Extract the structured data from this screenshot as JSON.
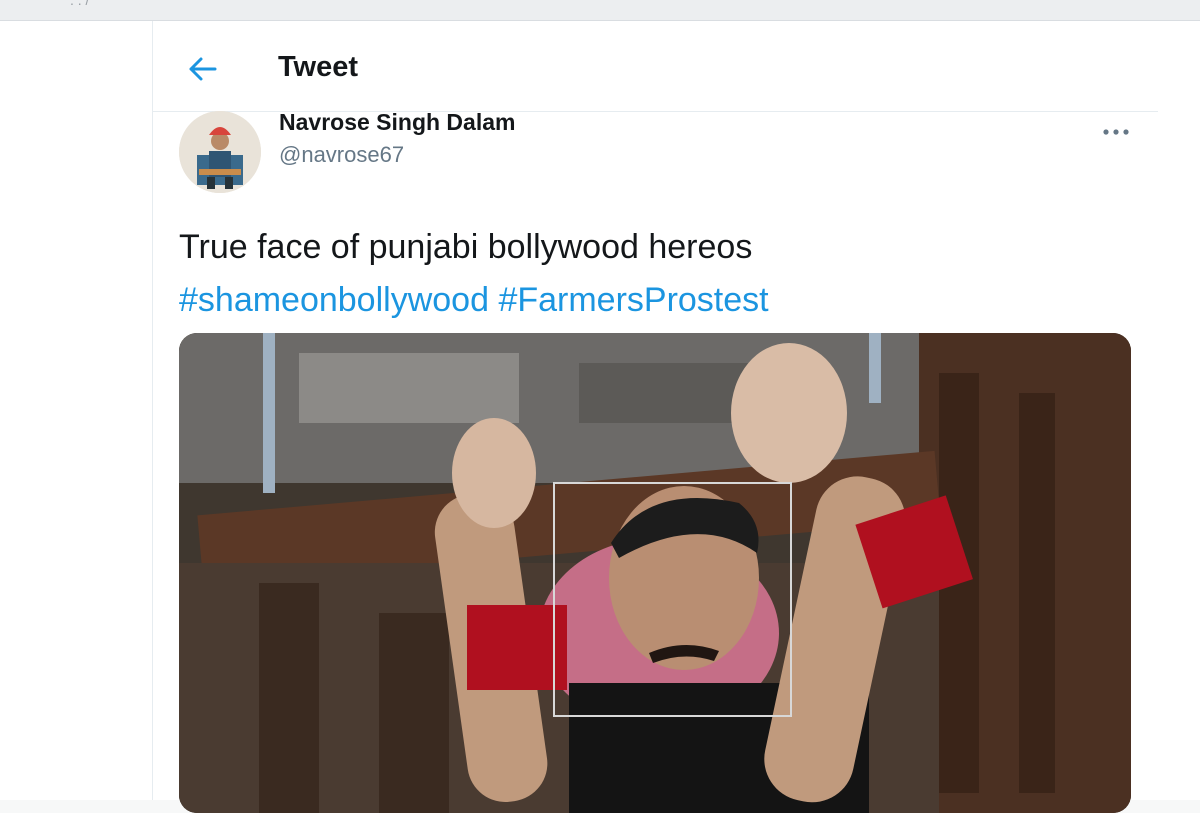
{
  "header": {
    "title": "Tweet"
  },
  "tweet": {
    "author": {
      "display_name": "Navrose Singh Dalam",
      "handle": "@navrose67"
    },
    "text": "True face of punjabi bollywood hereos",
    "hashtags": [
      "#shameonbollywood",
      "#FarmersProstest"
    ]
  },
  "colors": {
    "accent": "#1b95e0",
    "text": "#14171a",
    "secondary": "#657786"
  },
  "icons": {
    "back": "arrow-left-icon",
    "more": "more-horizontal-icon"
  }
}
